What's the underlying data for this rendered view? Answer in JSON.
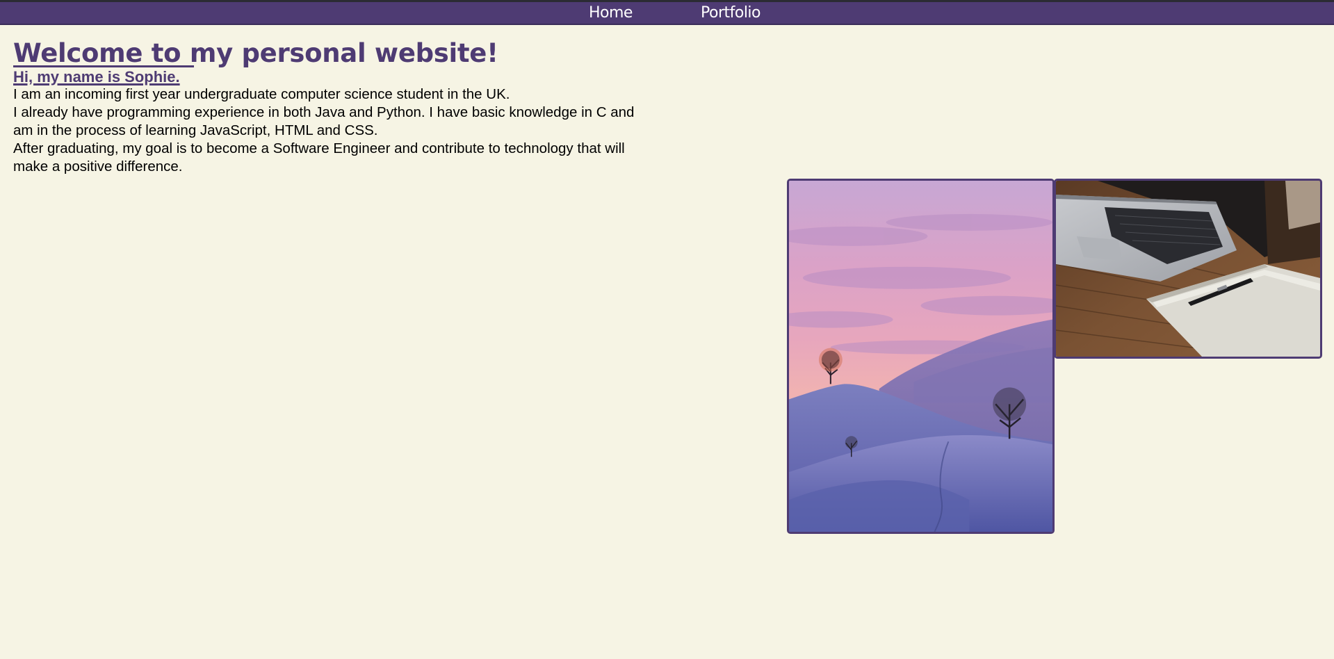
{
  "nav": {
    "home_label": "Home",
    "portfolio_label": "Portfolio"
  },
  "main": {
    "title": "Welcome to my personal website!",
    "subtitle": "Hi, my name is Sophie.",
    "paragraphs": [
      "I am an incoming first year undergraduate computer science student in the UK.",
      "I already have programming experience in both Java and Python. I have basic knowledge in C and am in the process of learning JavaScript, HTML and CSS.",
      "After graduating, my goal is to become a Software Engineer and contribute to technology that will make a positive difference."
    ]
  },
  "colors": {
    "accent": "#4e3b73",
    "background": "#f6f4e4",
    "text": "#000000"
  },
  "images": [
    {
      "subject": "snowy hills with trees under pink-purple sunset sky"
    },
    {
      "subject": "laptop and notebook with pen on wooden desk"
    }
  ]
}
